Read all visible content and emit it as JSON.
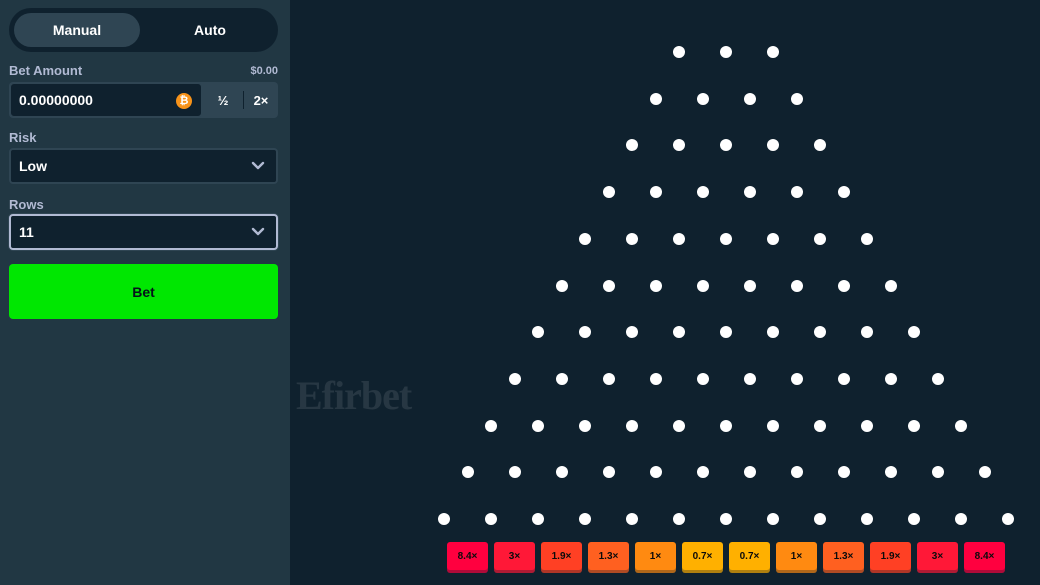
{
  "mode_tabs": {
    "manual": "Manual",
    "auto": "Auto"
  },
  "bet": {
    "label": "Bet Amount",
    "usd_value": "$0.00",
    "amount": "0.00000000",
    "currency_icon": "bitcoin-icon",
    "half_label": "½",
    "double_label": "2×"
  },
  "risk": {
    "label": "Risk",
    "value": "Low"
  },
  "rows": {
    "label": "Rows",
    "value": "11"
  },
  "bet_button": "Bet",
  "watermark": "Efirbet",
  "board": {
    "rows": 11,
    "pegs_first_row": 3
  },
  "multipliers": [
    {
      "label": "8.4×",
      "color": "#ff003f"
    },
    {
      "label": "3×",
      "color": "#ff1837"
    },
    {
      "label": "1.9×",
      "color": "#ff4024"
    },
    {
      "label": "1.3×",
      "color": "#ff6020"
    },
    {
      "label": "1×",
      "color": "#ff8a11"
    },
    {
      "label": "0.7×",
      "color": "#ffb000"
    },
    {
      "label": "0.7×",
      "color": "#ffb000"
    },
    {
      "label": "1×",
      "color": "#ff8a11"
    },
    {
      "label": "1.3×",
      "color": "#ff6020"
    },
    {
      "label": "1.9×",
      "color": "#ff4024"
    },
    {
      "label": "3×",
      "color": "#ff1837"
    },
    {
      "label": "8.4×",
      "color": "#ff003f"
    }
  ]
}
